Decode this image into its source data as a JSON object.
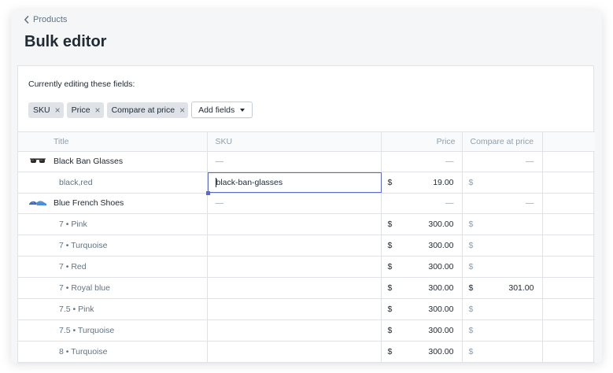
{
  "breadcrumb": {
    "label": "Products"
  },
  "page": {
    "title": "Bulk editor"
  },
  "editing": {
    "label": "Currently editing these fields:",
    "chips": [
      "SKU",
      "Price",
      "Compare at price"
    ],
    "add_fields_label": "Add fields"
  },
  "table": {
    "headers": {
      "title": "Title",
      "sku": "SKU",
      "price": "Price",
      "compare": "Compare at price"
    },
    "dash": "—",
    "currency": "$",
    "products": [
      {
        "title": "Black Ban Glasses",
        "thumb_icon": "sunglasses-icon",
        "variants": [
          {
            "title": "black,red",
            "sku": "black-ban-glasses",
            "price": "19.00",
            "compare": "",
            "editing": true
          }
        ]
      },
      {
        "title": "Blue French Shoes",
        "thumb_icon": "shoes-icon",
        "variants": [
          {
            "title": "7 • Pink",
            "sku": "",
            "price": "300.00",
            "compare": ""
          },
          {
            "title": "7 • Turquoise",
            "sku": "",
            "price": "300.00",
            "compare": ""
          },
          {
            "title": "7 • Red",
            "sku": "",
            "price": "300.00",
            "compare": ""
          },
          {
            "title": "7 • Royal blue",
            "sku": "",
            "price": "300.00",
            "compare": "301.00"
          },
          {
            "title": "7.5 • Pink",
            "sku": "",
            "price": "300.00",
            "compare": ""
          },
          {
            "title": "7.5 • Turquoise",
            "sku": "",
            "price": "300.00",
            "compare": ""
          },
          {
            "title": "8 • Turquoise",
            "sku": "",
            "price": "300.00",
            "compare": ""
          }
        ]
      }
    ]
  },
  "colors": {
    "accent": "#5c6ac4",
    "muted": "#919eab",
    "text": "#212b36",
    "subdued": "#637381"
  }
}
